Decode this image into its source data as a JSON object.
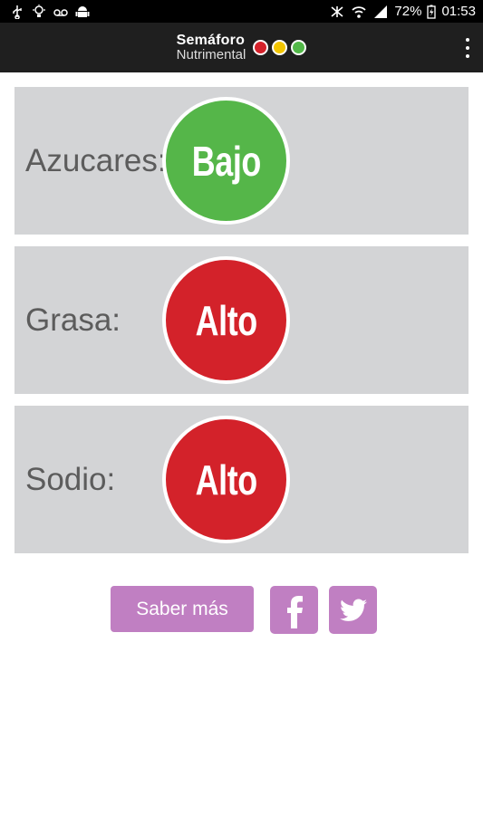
{
  "status_bar": {
    "battery": "72%",
    "time": "01:53"
  },
  "app_bar": {
    "logo_line1": "Semáforo",
    "logo_line2": "Nutrimental",
    "dot_colors": [
      "#d4212a",
      "#f2c500",
      "#52b848"
    ]
  },
  "nutrients": [
    {
      "label": "Azucares:",
      "level": "Bajo",
      "color": "#55b649"
    },
    {
      "label": "Grasa:",
      "level": "Alto",
      "color": "#d3222a"
    },
    {
      "label": "Sodio:",
      "level": "Alto",
      "color": "#d3222a"
    }
  ],
  "actions": {
    "more_label": "Saber más",
    "facebook_icon": "facebook-icon",
    "twitter_icon": "twitter-icon",
    "accent_color": "#c07fc2"
  }
}
